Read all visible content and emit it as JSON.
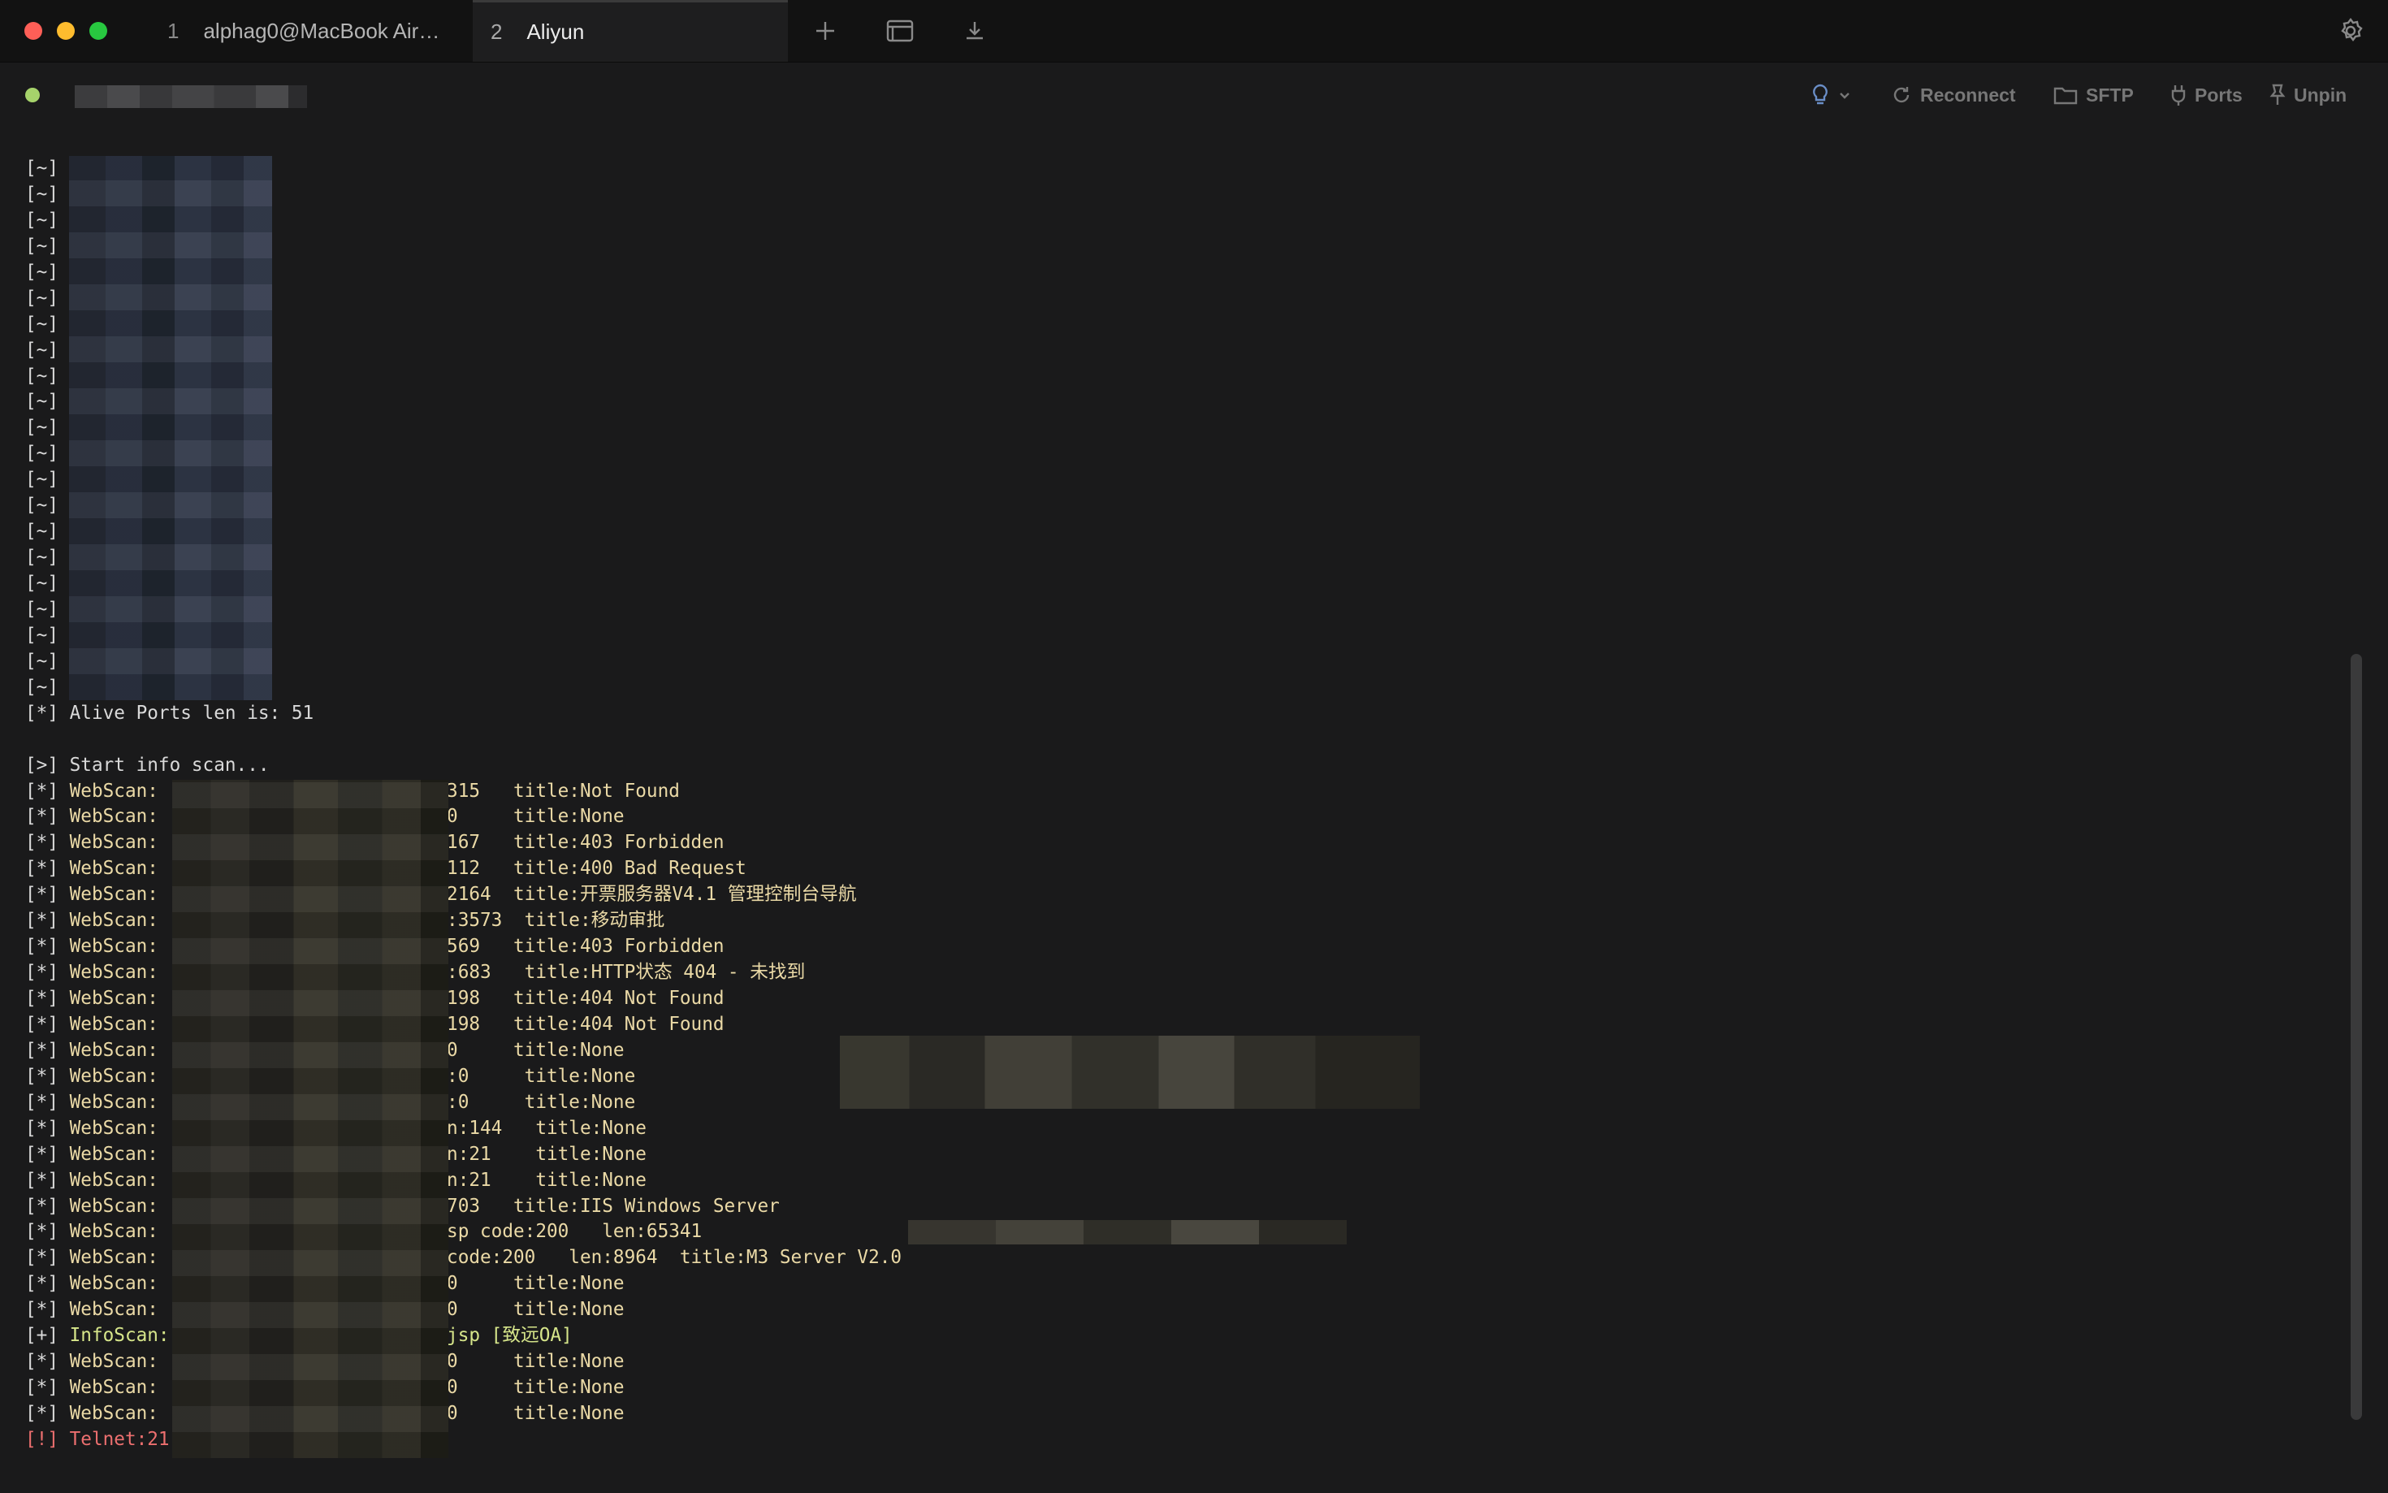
{
  "tabs": [
    {
      "num": "1",
      "label": "alphag0@MacBook Air…",
      "active": false
    },
    {
      "num": "2",
      "label": "Aliyun",
      "active": true
    }
  ],
  "toolbar": {
    "new_tab_icon": "plus-icon",
    "split_icon": "window-icon",
    "download_icon": "download-icon",
    "settings_icon": "gear-icon"
  },
  "session": {
    "status_color": "#a6d36b",
    "hint_icon": "lightbulb-icon",
    "actions": [
      {
        "icon": "reconnect-icon",
        "label": "Reconnect"
      },
      {
        "icon": "folder-icon",
        "label": "SFTP"
      },
      {
        "icon": "plug-icon",
        "label": "Ports"
      },
      {
        "icon": "pin-icon",
        "label": "Unpin"
      }
    ]
  },
  "terminal": {
    "lines": [
      {
        "p": "[~]",
        "t": "        open",
        "c": "c-blue"
      },
      {
        "p": "[~]",
        "t": "       8 open",
        "c": "c-blue"
      },
      {
        "p": "[~]",
        "t": "       0 open",
        "c": "c-blue"
      },
      {
        "p": "[~]",
        "t": "       080 open",
        "c": "c-blue"
      },
      {
        "p": "[~]",
        "t": "       002 open",
        "c": "c-blue"
      },
      {
        "p": "[~]",
        "t": "         open",
        "c": "c-blue"
      },
      {
        "p": "[~]",
        "t": "         open",
        "c": "c-blue"
      },
      {
        "p": "[~]",
        "t": "         open",
        "c": "c-blue"
      },
      {
        "p": "[~]",
        "t": "       1 open",
        "c": "c-blue"
      },
      {
        "p": "[~]",
        "t": "       8 open",
        "c": "c-blue"
      },
      {
        "p": "[~]",
        "t": "       008 open",
        "c": "c-blue"
      },
      {
        "p": "[~]",
        "t": "       9 open",
        "c": "c-blue"
      },
      {
        "p": "[~]",
        "t": "       9 open",
        "c": "c-blue"
      },
      {
        "p": "[~]",
        "t": "         open",
        "c": "c-blue"
      },
      {
        "p": "[~]",
        "t": "         open",
        "c": "c-blue"
      },
      {
        "p": "[~]",
        "t": "       8 open",
        "c": "c-blue"
      },
      {
        "p": "[~]",
        "t": "       8 open",
        "c": "c-blue"
      },
      {
        "p": "[~]",
        "t": "         open",
        "c": "c-blue"
      },
      {
        "p": "[~]",
        "t": "         open",
        "c": "c-blue"
      },
      {
        "p": "[~]",
        "t": "       0 open",
        "c": "c-blue"
      },
      {
        "p": "[~]",
        "t": "         open",
        "c": "c-blue"
      },
      {
        "p": "[*]",
        "t": " Alive Ports len is: 51",
        "c": "c-white"
      },
      {
        "p": "",
        "t": "",
        "c": "c-white"
      },
      {
        "p": "[>]",
        "t": " Start info scan...",
        "c": "c-white"
      },
      {
        "p": "[*]",
        "t": " WebScan:           code:404   len:315   title:Not Found",
        "c": "c-yellow"
      },
      {
        "p": "[*]",
        "t": " WebScan:           code:404   len:0     title:None",
        "c": "c-yellow"
      },
      {
        "p": "[*]",
        "t": " WebScan:           code:403   len:167   title:403 Forbidden",
        "c": "c-yellow"
      },
      {
        "p": "[*]",
        "t": " WebScan:           code:400   len:112   title:400 Bad Request",
        "c": "c-yellow"
      },
      {
        "p": "[*]",
        "t": " WebScan:           code:200   len:2164  title:开票服务器V4.1 管理控制台导航",
        "c": "c-yellow"
      },
      {
        "p": "[*]",
        "t": " WebScan:          3 code:200   len:3573  title:移动审批",
        "c": "c-yellow"
      },
      {
        "p": "[*]",
        "t": " WebScan:           code:403   len:569   title:403 Forbidden",
        "c": "c-yellow"
      },
      {
        "p": "[*]",
        "t": " WebScan:          0 code:404   len:683   title:HTTP状态 404 - 未找到",
        "c": "c-yellow"
      },
      {
        "p": "[*]",
        "t": " WebScan:           code:404   len:198   title:404 Not Found",
        "c": "c-yellow"
      },
      {
        "p": "[*]",
        "t": " WebScan:           code:404   len:198   title:404 Not Found",
        "c": "c-yellow"
      },
      {
        "p": "[*]",
        "t": " WebScan:           code:301   len:0     title:None",
        "c": "c-yellow"
      },
      {
        "p": "[*]",
        "t": " WebScan:          0 code:302   len:0     title:None",
        "c": "c-yellow"
      },
      {
        "p": "[*]",
        "t": " WebScan:          0 code:302   len:0     title:None",
        "c": "c-yellow"
      },
      {
        "p": "[*]",
        "t": " WebScan:          81 code:404   len:144   title:None",
        "c": "c-yellow"
      },
      {
        "p": "[*]",
        "t": " WebScan:          08 code:500   len:21    title:None",
        "c": "c-yellow"
      },
      {
        "p": "[*]",
        "t": " WebScan:          08 code:500   len:21    title:None",
        "c": "c-yellow"
      },
      {
        "p": "[*]",
        "t": " WebScan:           code:200   len:703   title:IIS Windows Server",
        "c": "c-yellow"
      },
      {
        "p": "[*]",
        "t": " WebScan:          0/seeyon/index.jsp code:200   len:65341",
        "c": "c-yellow"
      },
      {
        "p": "[*]",
        "t": " WebScan:          0/mobile_portal code:200   len:8964  title:M3 Server V2.0",
        "c": "c-yellow"
      },
      {
        "p": "[*]",
        "t": " WebScan:           code:200   len:0     title:None",
        "c": "c-yellow"
      },
      {
        "p": "[*]",
        "t": " WebScan:           code:200   len:0     title:None",
        "c": "c-yellow"
      },
      {
        "p": "[+]",
        "t": " InfoScan:         00/seeyon/index.jsp [致远OA]",
        "c": "c-infoscan"
      },
      {
        "p": "[*]",
        "t": " WebScan:           code:200   len:0     title:None",
        "c": "c-yellow"
      },
      {
        "p": "[*]",
        "t": " WebScan:           code:200   len:0     title:None",
        "c": "c-yellow"
      },
      {
        "p": "[*]",
        "t": " WebScan:           code:200   len:0     title:None",
        "c": "c-yellow"
      },
      {
        "p": "[!]",
        "t": " Telnet:21",
        "c": "c-red"
      }
    ]
  }
}
